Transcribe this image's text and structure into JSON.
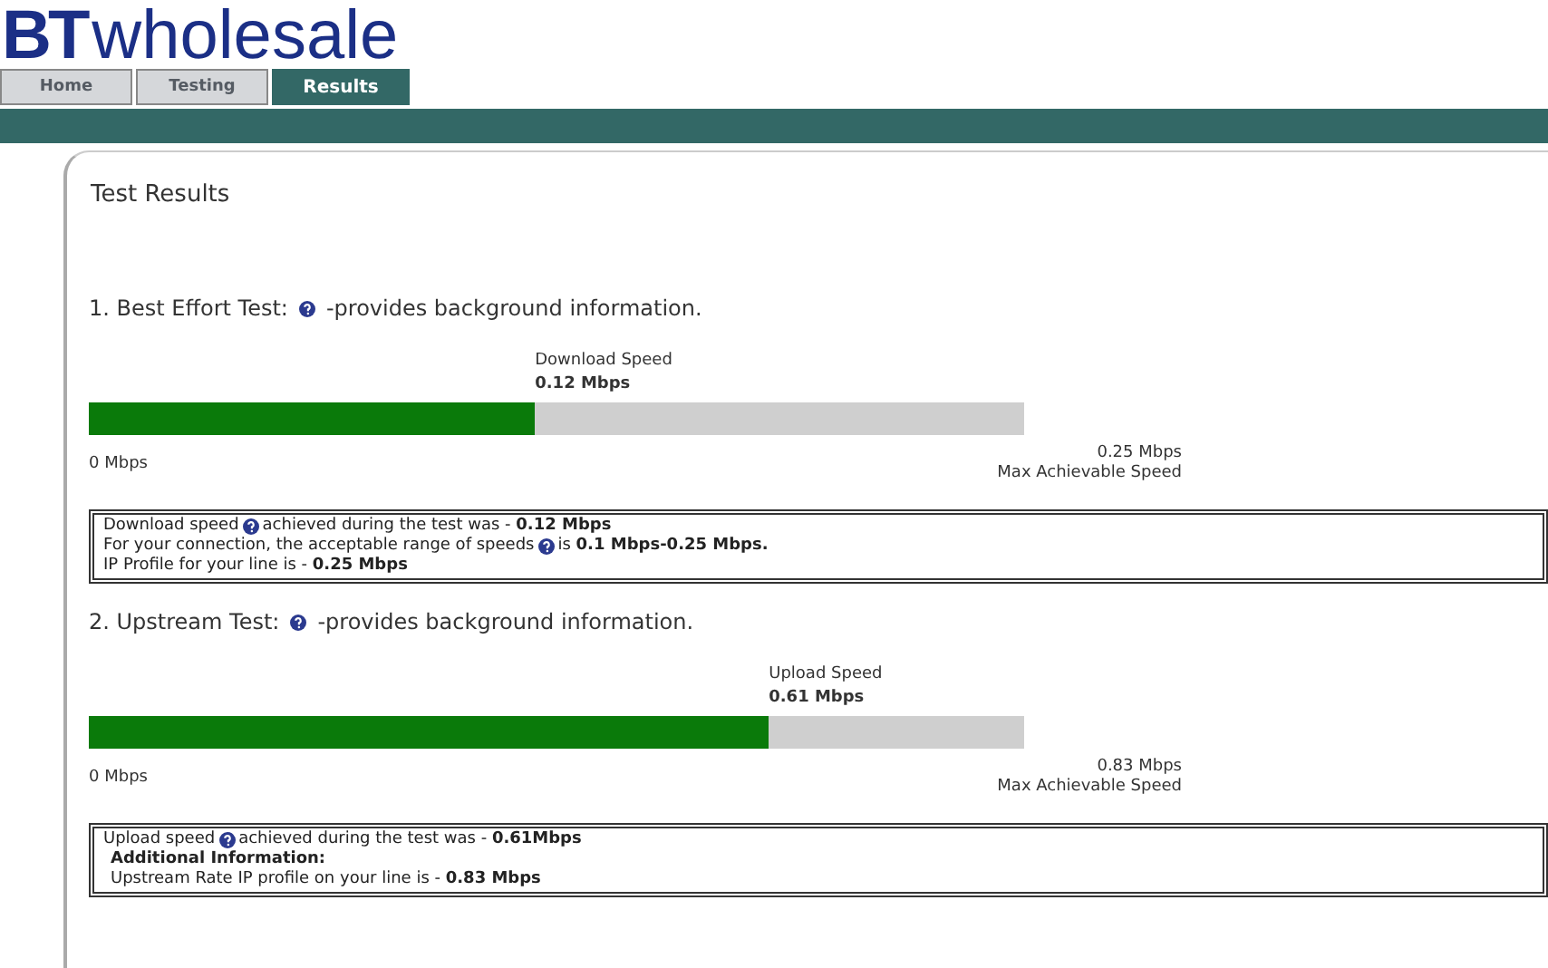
{
  "logo": {
    "brand": "BT",
    "name": "wholesale"
  },
  "tabs": [
    {
      "label": "Home",
      "selected": false
    },
    {
      "label": "Testing",
      "selected": false
    },
    {
      "label": "Results",
      "selected": true
    }
  ],
  "page_title": "Test Results",
  "tests": [
    {
      "heading": "1. Best Effort Test:",
      "help_note": "-provides background information.",
      "speed_label": "Download  Speed",
      "speed_value": "0.12 Mbps",
      "level": 0.477,
      "min_label": "0 Mbps",
      "max_value": "0.25 Mbps",
      "max_label": "Max Achievable Speed",
      "info_lines": [
        {
          "kind": "help",
          "before": "Download speed",
          "after": "achieved during the test was - **0.12 Mbps**"
        },
        {
          "kind": "help",
          "before": "For your connection, the acceptable range of speeds",
          "after": " is **0.1 Mbps-0.25 Mbps.**"
        },
        {
          "kind": "plain",
          "text": "IP Profile for your line is - **0.25 Mbps**"
        }
      ]
    },
    {
      "heading": "2. Upstream Test:",
      "help_note": "-provides background information.",
      "speed_label": "Upload Speed",
      "speed_value": "0.61 Mbps",
      "level": 0.727,
      "min_label": "0 Mbps",
      "max_value": "0.83 Mbps",
      "max_label": "Max Achievable Speed",
      "info_lines": [
        {
          "kind": "help",
          "before": "Upload speed",
          "after": " achieved during the test was - **0.61Mbps**"
        },
        {
          "kind": "subheading",
          "text": "Additional Information:"
        },
        {
          "kind": "note",
          "text": "Upstream Rate IP profile on your line is - **0.83 Mbps**"
        }
      ]
    }
  ]
}
